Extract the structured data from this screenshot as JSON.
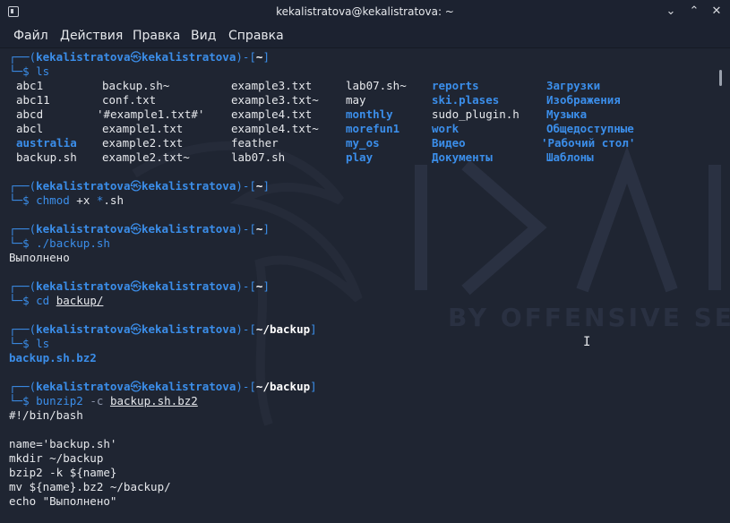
{
  "window": {
    "title": "kekalistratova@kekalistratova: ~",
    "minimize": "⌄",
    "maximize": "⌃",
    "close": "✕"
  },
  "menu": [
    "Файл",
    "Действия",
    "Правка",
    "Вид",
    "Справка"
  ],
  "prompt": {
    "user": "kekalistratova",
    "host": "kekalistratova",
    "skull": "㉿",
    "dollar": "$"
  },
  "blocks": [
    {
      "path": "~",
      "command": "ls",
      "ls_columns": [
        [
          {
            "t": "abc1"
          },
          {
            "t": "abc11"
          },
          {
            "t": "abcd"
          },
          {
            "t": "abcl"
          },
          {
            "t": "australia",
            "dir": true
          },
          {
            "t": "backup.sh"
          }
        ],
        [
          {
            "t": "backup.sh~"
          },
          {
            "t": "conf.txt"
          },
          {
            "t": "'#example1.txt#'"
          },
          {
            "t": "example1.txt"
          },
          {
            "t": "example2.txt"
          },
          {
            "t": "example2.txt~"
          }
        ],
        [
          {
            "t": "example3.txt"
          },
          {
            "t": "example3.txt~"
          },
          {
            "t": "example4.txt"
          },
          {
            "t": "example4.txt~"
          },
          {
            "t": "feather"
          },
          {
            "t": "lab07.sh"
          }
        ],
        [
          {
            "t": "lab07.sh~"
          },
          {
            "t": "may"
          },
          {
            "t": "monthly",
            "dir": true
          },
          {
            "t": "morefun1",
            "dir": true
          },
          {
            "t": "my_os",
            "dir": true
          },
          {
            "t": "play",
            "dir": true
          }
        ],
        [
          {
            "t": "reports",
            "dir": true
          },
          {
            "t": "ski.plases",
            "dir": true
          },
          {
            "t": "sudo_plugin.h"
          },
          {
            "t": "work",
            "dir": true
          },
          {
            "t": "Видео",
            "dir": true
          },
          {
            "t": "Документы",
            "dir": true
          }
        ],
        [
          {
            "t": "Загрузки",
            "dir": true
          },
          {
            "t": "Изображения",
            "dir": true
          },
          {
            "t": "Музыка",
            "dir": true
          },
          {
            "t": "Общедоступные",
            "dir": true
          },
          {
            "t": "'Рабочий стол'",
            "dir": true
          },
          {
            "t": "Шаблоны",
            "dir": true
          }
        ]
      ]
    },
    {
      "path": "~",
      "cmd": "chmod",
      "args": "+x *.sh"
    },
    {
      "path": "~",
      "cmd": "./backup.sh",
      "output": "Выполнено"
    },
    {
      "path": "~",
      "cmd": "cd",
      "args": "backup/"
    },
    {
      "path": "~/backup",
      "cmd": "ls",
      "output_dir": "backup.sh.bz2"
    },
    {
      "path": "~/backup",
      "cmd": "bunzip2",
      "flag": "-c",
      "args": "backup.sh.bz2",
      "output_lines": [
        "#!/bin/bash",
        "",
        "name='backup.sh'",
        "mkdir ~/backup",
        "bzip2 -k ${name}",
        "mv ${name}.bz2 ~/backup/",
        "echo \"Выполнено\""
      ]
    }
  ]
}
